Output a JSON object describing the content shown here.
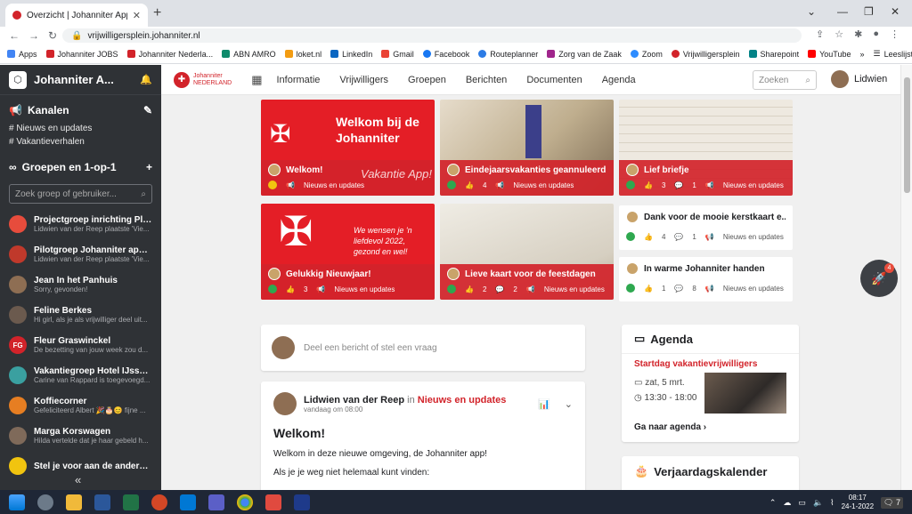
{
  "browser": {
    "tab_title": "Overzicht | Johanniter App",
    "url": "vrijwilligersplein.johanniter.nl",
    "bookmarks": [
      "Apps",
      "Johanniter JOBS",
      "Johanniter Nederla...",
      "ABN AMRO",
      "loket.nl",
      "LinkedIn",
      "Gmail",
      "Facebook",
      "Routeplanner",
      "Zorg van de Zaak",
      "Zoom",
      "Vrijwilligersplein",
      "Sharepoint",
      "YouTube"
    ],
    "reading_list": "Leeslijst"
  },
  "sidebar": {
    "app_title": "Johanniter A...",
    "channels_heading": "Kanalen",
    "channels": [
      "# Nieuws en updates",
      "# Vakantieverhalen"
    ],
    "groups_heading": "Groepen en 1-op-1",
    "search_placeholder": "Zoek groep of gebruiker...",
    "conversations": [
      {
        "name": "Projectgroep inrichting Plek",
        "sub": "Lidwien van der Reep plaatste 'Vie...",
        "color": "#e74c3c",
        "initials": ""
      },
      {
        "name": "Pilotgroep Johanniter app 1...",
        "sub": "Lidwien van der Reep plaatste 'Vie...",
        "color": "#c0392b",
        "initials": ""
      },
      {
        "name": "Jean In het Panhuis",
        "sub": "Sorry, gevonden!",
        "color": "#8e6e53",
        "initials": ""
      },
      {
        "name": "Feline Berkes",
        "sub": "Hi girl, als je als vrijwilliger deel uit...",
        "color": "#6b5a4e",
        "initials": ""
      },
      {
        "name": "Fleur Graswinckel",
        "sub": "De bezetting van jouw week zou d...",
        "color": "#d2232a",
        "initials": "FG"
      },
      {
        "name": "Vakantiegroep Hotel IJsselM...",
        "sub": "Carine van Rappard is toegevoegd...",
        "color": "#3aa0a0",
        "initials": ""
      },
      {
        "name": "Koffiecorner",
        "sub": "Gefeliciteerd Albert 🎉🎂😊 fijne ...",
        "color": "#e67e22",
        "initials": ""
      },
      {
        "name": "Marga Korswagen",
        "sub": "Hilda vertelde dat je haar gebeld h...",
        "color": "#7f6a5a",
        "initials": ""
      },
      {
        "name": "Stel je voor aan de andere v...",
        "sub": "",
        "color": "#f1c40f",
        "initials": ""
      }
    ]
  },
  "nav": {
    "brand": "Johanniter",
    "brand_sub": "NEDERLAND",
    "links": [
      "Informatie",
      "Vrijwilligers",
      "Groepen",
      "Berichten",
      "Documenten",
      "Agenda"
    ],
    "search_placeholder": "Zoeken",
    "user_name": "Lidwien"
  },
  "tiles": [
    {
      "title": "Welkom!",
      "likes": "",
      "comments": "",
      "channel": "Nieuws en updates",
      "image_text": "Welkom bij de Johanniter",
      "image_text2": "Vakantie App!"
    },
    {
      "title": "Eindejaarsvakanties geannuleerd",
      "likes": "4",
      "comments": "",
      "channel": "Nieuws en updates"
    },
    {
      "title": "Lief briefje",
      "likes": "3",
      "comments": "1",
      "channel": "Nieuws en updates"
    },
    {
      "title": "Gelukkig Nieuwjaar!",
      "likes": "3",
      "comments": "",
      "channel": "Nieuws en updates",
      "image_text": "We wensen je 'n liefdevol 2022, gezond en wel!"
    },
    {
      "title": "Lieve kaart voor de feestdagen",
      "likes": "2",
      "comments": "2",
      "channel": "Nieuws en updates"
    },
    {
      "title": "Dank voor de mooie kerstkaart e...",
      "likes": "4",
      "comments": "1",
      "channel": "Nieuws en updates"
    },
    {
      "title": "In warme Johanniter handen",
      "likes": "1",
      "comments": "8",
      "channel": "Nieuws en updates"
    }
  ],
  "composer": {
    "placeholder": "Deel een bericht of stel een vraag"
  },
  "post": {
    "author": "Lidwien van der Reep",
    "in": "in",
    "channel": "Nieuws en updates",
    "time": "vandaag om 08:00",
    "title": "Welkom!",
    "p1": "Welkom in deze nieuwe omgeving, de Johanniter app!",
    "p2": "Als je je weg niet helemaal kunt vinden:"
  },
  "agenda": {
    "heading": "Agenda",
    "event": "Startdag vakantievrijwilligers",
    "date": "zat, 5 mrt.",
    "time": "13:30 - 18:00",
    "link": "Ga naar agenda"
  },
  "birthdays": {
    "heading": "Verjaardagskalender"
  },
  "fab": {
    "badge": "4"
  },
  "taskbar": {
    "time": "08:17",
    "date": "24-1-2022",
    "notif": "7"
  },
  "colors": {
    "brand": "#d2232a",
    "sidebar": "#2f3236",
    "success": "#2ea84f"
  }
}
